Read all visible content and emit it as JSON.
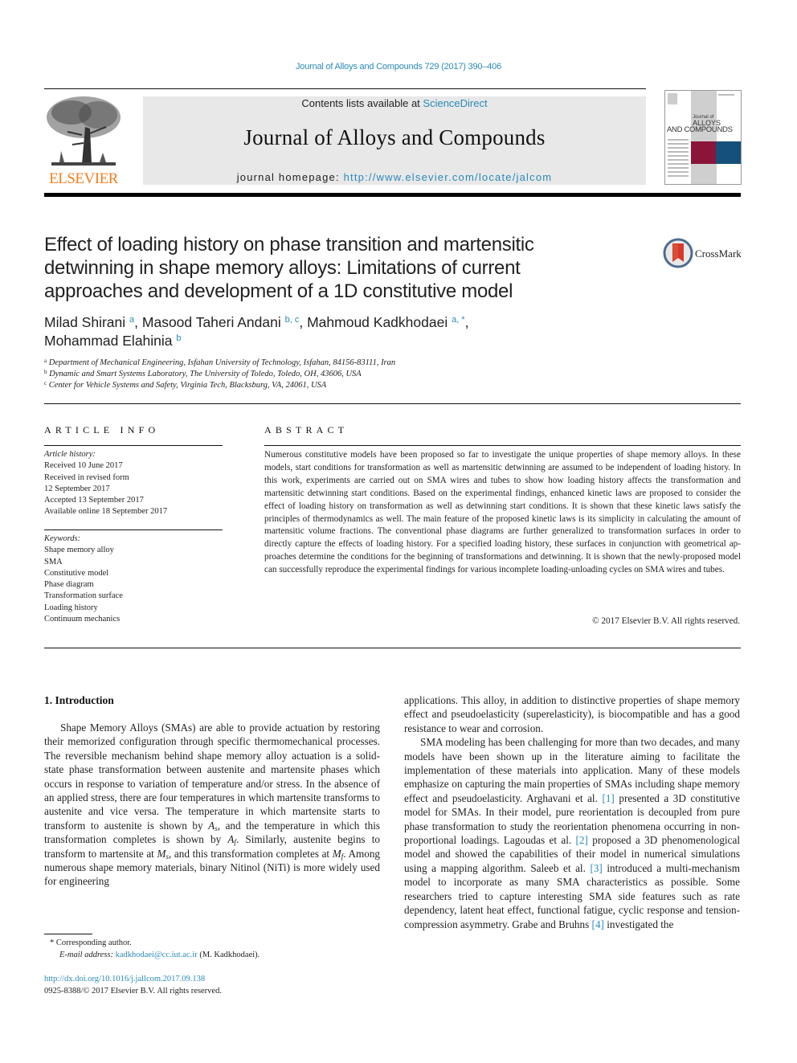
{
  "header": {
    "journal_reference": "Journal of Alloys and Compounds 729 (2017) 390–406",
    "contents_prefix": "Contents lists available at ",
    "contents_link": "ScienceDirect",
    "journal_title": "Journal of Alloys and Compounds",
    "homepage_prefix": "journal homepage: ",
    "homepage_url": "http://www.elsevier.com/locate/jalcom",
    "publisher_logo_text": "ELSEVIER",
    "cover": {
      "line1": "Journal of",
      "line2": "ALLOYS",
      "line3": "AND COMPOUNDS",
      "accent_red": "#8a1538",
      "accent_blue": "#14507a"
    },
    "crossmark_label": "CrossMark"
  },
  "article": {
    "title": "Effect of loading history on phase transition and martensitic detwinning in shape memory alloys: Limitations of current approaches and development of a 1D constitutive model",
    "authors": [
      {
        "name": "Milad Shirani",
        "sup": "a"
      },
      {
        "name": "Masood Taheri Andani",
        "sup": "b, c"
      },
      {
        "name": "Mahmoud Kadkhodaei",
        "sup": "a, *"
      },
      {
        "name": "Mohammad Elahinia",
        "sup": "b"
      }
    ],
    "affiliations": [
      {
        "key": "a",
        "text": "Department of Mechanical Engineering, Isfahan University of Technology, Isfahan, 84156-83111, Iran"
      },
      {
        "key": "b",
        "text": "Dynamic and Smart Systems Laboratory, The University of Toledo, Toledo, OH, 43606, USA"
      },
      {
        "key": "c",
        "text": "Center for Vehicle Systems and Safety, Virginia Tech, Blacksburg, VA, 24061, USA"
      }
    ]
  },
  "article_info": {
    "heading": "ARTICLE INFO",
    "history_label": "Article history:",
    "history": [
      "Received 10 June 2017",
      "Received in revised form",
      "12 September 2017",
      "Accepted 13 September 2017",
      "Available online 18 September 2017"
    ],
    "keywords_label": "Keywords:",
    "keywords": [
      "Shape memory alloy",
      "SMA",
      "Constitutive model",
      "Phase diagram",
      "Transformation surface",
      "Loading history",
      "Continuum mechanics"
    ]
  },
  "abstract": {
    "heading": "ABSTRACT",
    "text": "Numerous constitutive models have been proposed so far to investigate the unique properties of shape memory alloys. In these models, start conditions for transformation as well as martensitic detwinning are assumed to be independent of loading history. In this work, experiments are carried out on SMA wires and tubes to show how loading history affects the transformation and martensitic detwinning start conditions. Based on the experimental findings, enhanced kinetic laws are proposed to consider the effect of loading history on transformation as well as detwinning start conditions. It is shown that these kinetic laws satisfy the principles of thermodynamics as well. The main feature of the proposed kinetic laws is its simplicity in calculating the amount of martensitic volume fractions. The conventional phase diagrams are further generalized to transformation surfaces in order to directly capture the effects of loading history. For a specified loading history, these surfaces in conjunction with geometrical ap­proaches determine the conditions for the beginning of transformations and detwinning. It is shown that the newly-proposed model can successfully reproduce the experimental findings for various incomplete loading-unloading cycles on SMA wires and tubes.",
    "copyright": "© 2017 Elsevier B.V. All rights reserved."
  },
  "introduction": {
    "heading": "1.  Introduction",
    "left_col": {
      "p1_a": "Shape Memory Alloys (SMAs) are able to provide actuation by restoring their memorized configuration through specific thermo­mechanical processes. The reversible mechanism behind shape memory alloy actuation is a solid-state phase transformation be­tween austenite and martensite phases which occurs in response to variation of temperature and/or stress. In the absence of an applied stress, there are four temperatures in which martensite transforms to austenite and vice versa. The temperature in which martensite starts to transform to austenite is shown by ",
      "sym_As_base": "A",
      "sym_As_sub": "s",
      "p1_b": ", and the temperature in which this transformation completes is shown by ",
      "sym_Af_base": "A",
      "sym_Af_sub": "f",
      "p1_c": ". Similarly, austenite begins to transform to martensite at ",
      "sym_Ms_base": "M",
      "sym_Ms_sub": "s",
      "p1_d": ", and this trans­formation completes at ",
      "sym_Mf_base": "M",
      "sym_Mf_sub": "f",
      "p1_e": ". Among numerous shape memory ma­terials, binary Nitinol (NiTi) is more widely used for engineering"
    },
    "right_col": {
      "p1": "applications. This alloy, in addition to distinctive properties of shape memory effect and pseudoelasticity (superelasticity), is biocompatible and has a good resistance to wear and corrosion.",
      "p2_a": "SMA modeling has been challenging for more than two decades, and many models have been shown up in the literature aiming to facilitate the implementation of these materials into application. Many of these models emphasize on capturing the main properties of SMAs including shape memory effect and pseudoelasticity. Arghavani et al. ",
      "ref1": "[1]",
      "p2_b": " presented a 3D constitutive model for SMAs. In their model, pure reorientation is decoupled from pure phase transformation to study the reorientation phenomena occurring in non-proportional loadings. Lagoudas et al. ",
      "ref2": "[2]",
      "p2_c": " proposed a 3D phenomenological model and showed the capabilities of their model in numerical simulations using a mapping algorithm. Saleeb et al. ",
      "ref3": "[3]",
      "p2_d": " introduced a multi-mechanism model to incorporate as many SMA characteristics as possible. Some researchers tried to capture interesting SMA side features such as rate dependency, latent heat effect, functional fatigue, cyclic response and tension-compression asymmetry. Grabe and Bruhns ",
      "ref4": "[4]",
      "p2_e": " investigated the"
    }
  },
  "footnotes": {
    "corresponding": "* Corresponding author.",
    "email_label": "E-mail address: ",
    "email": "kadkhodaei@cc.iut.ac.ir",
    "email_suffix": " (M. Kadkhodaei).",
    "doi": "http://dx.doi.org/10.1016/j.jallcom.2017.09.138",
    "issn_copyright": "0925-8388/© 2017 Elsevier B.V. All rights reserved."
  }
}
